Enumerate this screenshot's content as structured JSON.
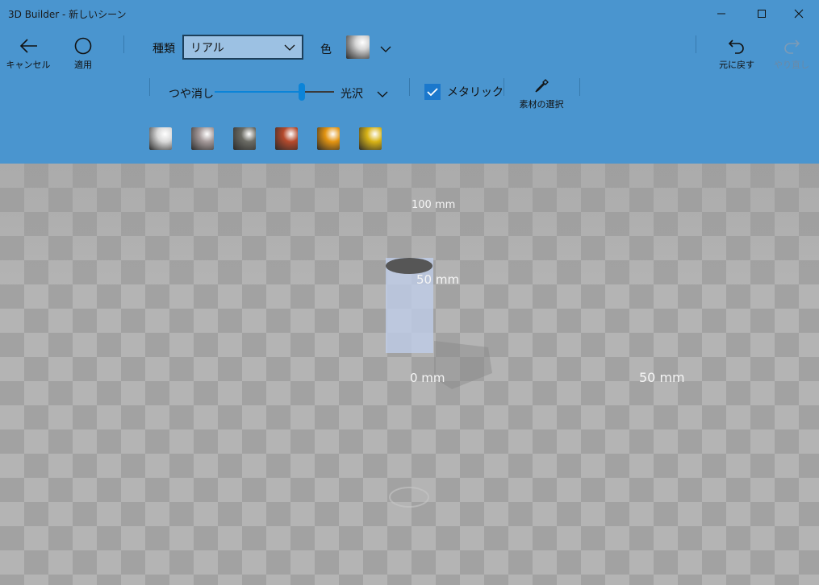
{
  "window": {
    "title": "3D Builder - 新しいシーン"
  },
  "toolbar": {
    "cancel_label": "キャンセル",
    "apply_label": "適用",
    "undo_label": "元に戻す",
    "redo_label": "やり直し"
  },
  "material": {
    "type_label": "種類",
    "type_value": "リアル",
    "color_label": "色",
    "matte_label": "つや消し",
    "gloss_label": "光沢",
    "gloss_level": 0.73,
    "metallic_label": "メタリック",
    "metallic_checked": true,
    "pick_material_label": "素材の選択",
    "swatches": [
      {
        "name": "silver",
        "color": "#d9d9d9"
      },
      {
        "name": "pewter",
        "color": "#a59a9a"
      },
      {
        "name": "dark-steel",
        "color": "#6b6b64"
      },
      {
        "name": "copper",
        "color": "#b54a2c"
      },
      {
        "name": "orange-gold",
        "color": "#e39411"
      },
      {
        "name": "gold",
        "color": "#d8b315"
      }
    ]
  },
  "viewport": {
    "label_100": "100 mm",
    "label_50_partial": "50 mm",
    "label_0": "0 mm",
    "label_50": "50 mm"
  },
  "colors": {
    "ribbon": "#4a95cf",
    "accent": "#0b84d8"
  }
}
